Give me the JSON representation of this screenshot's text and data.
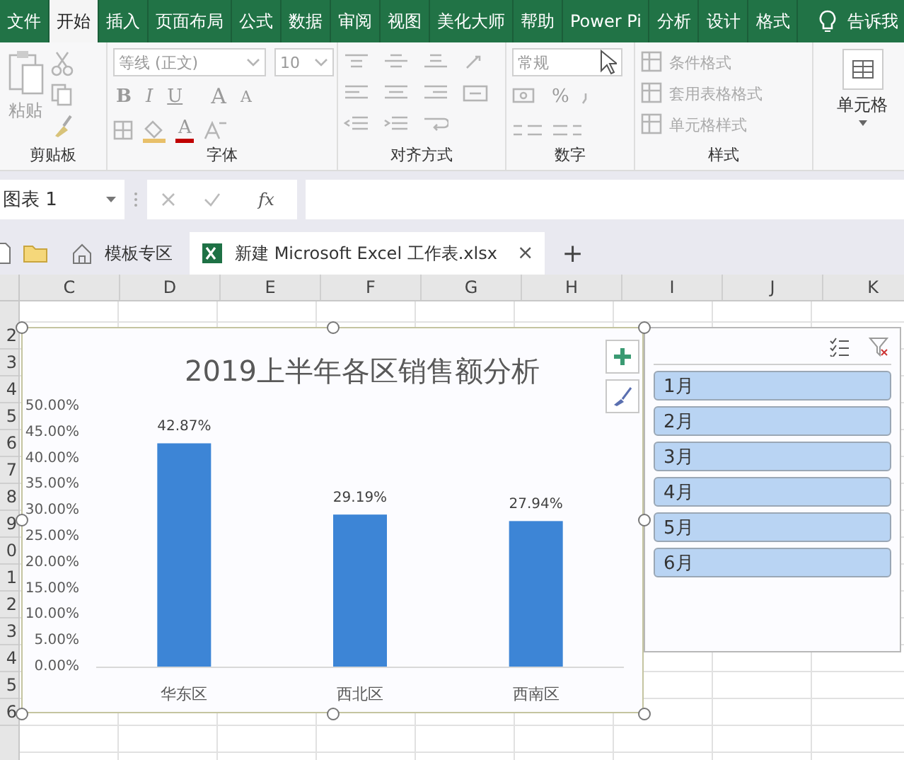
{
  "ribbon": {
    "tabs": [
      {
        "label": "文件",
        "selected": false
      },
      {
        "label": "开始",
        "selected": true
      },
      {
        "label": "插入",
        "selected": false
      },
      {
        "label": "页面布局",
        "selected": false
      },
      {
        "label": "公式",
        "selected": false
      },
      {
        "label": "数据",
        "selected": false
      },
      {
        "label": "审阅",
        "selected": false
      },
      {
        "label": "视图",
        "selected": false
      },
      {
        "label": "美化大师",
        "selected": false
      },
      {
        "label": "帮助",
        "selected": false
      },
      {
        "label": "Power Pi",
        "selected": false
      },
      {
        "label": "分析",
        "selected": false
      },
      {
        "label": "设计",
        "selected": false
      },
      {
        "label": "格式",
        "selected": false
      }
    ],
    "tell_me": "告诉我",
    "clipboard": {
      "paste": "粘贴",
      "label": "剪贴板"
    },
    "font": {
      "name": "等线 (正文)",
      "size": "10",
      "bold": "B",
      "italic": "I",
      "underline": "U",
      "grow": "A",
      "shrink": "A",
      "font_color_button": "A",
      "label": "字体"
    },
    "alignment": {
      "label": "对齐方式"
    },
    "number": {
      "format": "常规",
      "percent": "%",
      "label": "数字"
    },
    "styles": {
      "items": [
        "条件格式",
        "套用表格格式",
        "单元格样式"
      ],
      "label": "样式"
    },
    "cells": {
      "button": "单元格"
    }
  },
  "formula_bar": {
    "name_box": "图表 1",
    "fx": "fx"
  },
  "doc_tabs": {
    "tabs": [
      {
        "label": "模板专区",
        "kind": "home",
        "selected": false
      },
      {
        "label": "新建 Microsoft Excel 工作表.xlsx",
        "kind": "excel",
        "selected": true,
        "close": "×"
      }
    ],
    "new_tab": "+"
  },
  "sheet": {
    "columns": [
      "C",
      "D",
      "E",
      "F",
      "G",
      "H",
      "I",
      "J",
      "K"
    ],
    "rows": [
      "2",
      "3",
      "4",
      "5",
      "6",
      "7",
      "8",
      "9",
      "0",
      "1",
      "2",
      "3",
      "4",
      "5",
      "6"
    ],
    "chart": {
      "chart_data": {
        "type": "bar",
        "title": "2019上半年各区销售额分析",
        "categories": [
          "华东区",
          "西北区",
          "西南区"
        ],
        "series": [
          {
            "color": "#3d85d6",
            "values": [
              42.87,
              29.19,
              27.94
            ]
          }
        ],
        "ylim": [
          0,
          50
        ],
        "yticks": [
          {
            "value": 0,
            "label": "0.00%"
          },
          {
            "value": 5,
            "label": "5.00%"
          },
          {
            "value": 10,
            "label": "10.00%"
          },
          {
            "value": 15,
            "label": "15.00%"
          },
          {
            "value": 20,
            "label": "20.00%"
          },
          {
            "value": 25,
            "label": "25.00%"
          },
          {
            "value": 30,
            "label": "30.00%"
          },
          {
            "value": 35,
            "label": "35.00%"
          },
          {
            "value": 40,
            "label": "40.00%"
          },
          {
            "value": 45,
            "label": "45.00%"
          },
          {
            "value": 50,
            "label": "50.00%"
          }
        ],
        "value_labels": [
          "42.87%",
          "29.19%",
          "27.94%"
        ]
      }
    },
    "slicer": {
      "items": [
        {
          "label": "1月",
          "selected": true
        },
        {
          "label": "2月",
          "selected": true
        },
        {
          "label": "3月",
          "selected": true
        },
        {
          "label": "4月",
          "selected": true
        },
        {
          "label": "5月",
          "selected": true
        },
        {
          "label": "6月",
          "selected": true
        }
      ]
    }
  }
}
